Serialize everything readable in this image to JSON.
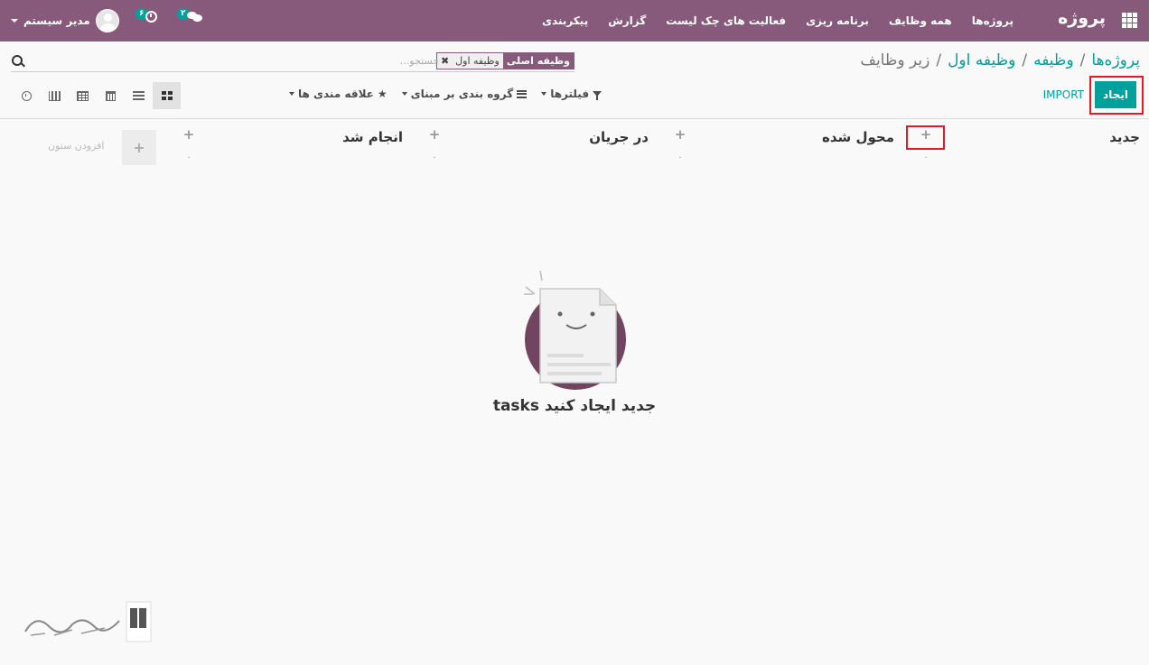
{
  "navbar": {
    "brand": "پروژه",
    "menu": [
      "پروژه‌ها",
      "همه وظایف",
      "برنامه ریزی",
      "فعالیت های چک لیست",
      "گزارش",
      "پیکربندی"
    ],
    "user_name": "مدیر سیستم",
    "activity_count": "۶",
    "messages_count": "۲",
    "icons": [
      "apps-icon",
      "activity-clock-icon",
      "chat-icon",
      "avatar"
    ]
  },
  "breadcrumb": {
    "items": [
      "پروژه‌ها",
      "وظیفه",
      "وظیفه اول"
    ],
    "active": "زیر وظایف",
    "separator": "/"
  },
  "search": {
    "facet_label": "وظیفه اصلی",
    "facet_value": "وظیفه اول",
    "facet_remove": "✖",
    "placeholder": "جستجو..."
  },
  "buttons": {
    "create": "ایجاد",
    "import": "IMPORT"
  },
  "filters": {
    "filters_label": "فیلترها",
    "group_by_label": "گروه بندی بر مبنای",
    "favorites_label": "علاقه مندی ها"
  },
  "views": [
    "activity",
    "graph",
    "pivot",
    "calendar",
    "list",
    "kanban"
  ],
  "active_view": "kanban",
  "columns": [
    {
      "title": "جدید",
      "count": ""
    },
    {
      "title": "محول شده",
      "count": "۰"
    },
    {
      "title": "در جریان",
      "count": "۰"
    },
    {
      "title": "انجام شد",
      "count": "۰"
    }
  ],
  "add_column": {
    "label": "افزودن ستون",
    "plus": "+"
  },
  "empty_state": {
    "title": "tasks جدید ایجاد کنید"
  },
  "colors": {
    "primary": "#875a7b",
    "accent": "#00a09d",
    "highlight": "#e01b24"
  }
}
